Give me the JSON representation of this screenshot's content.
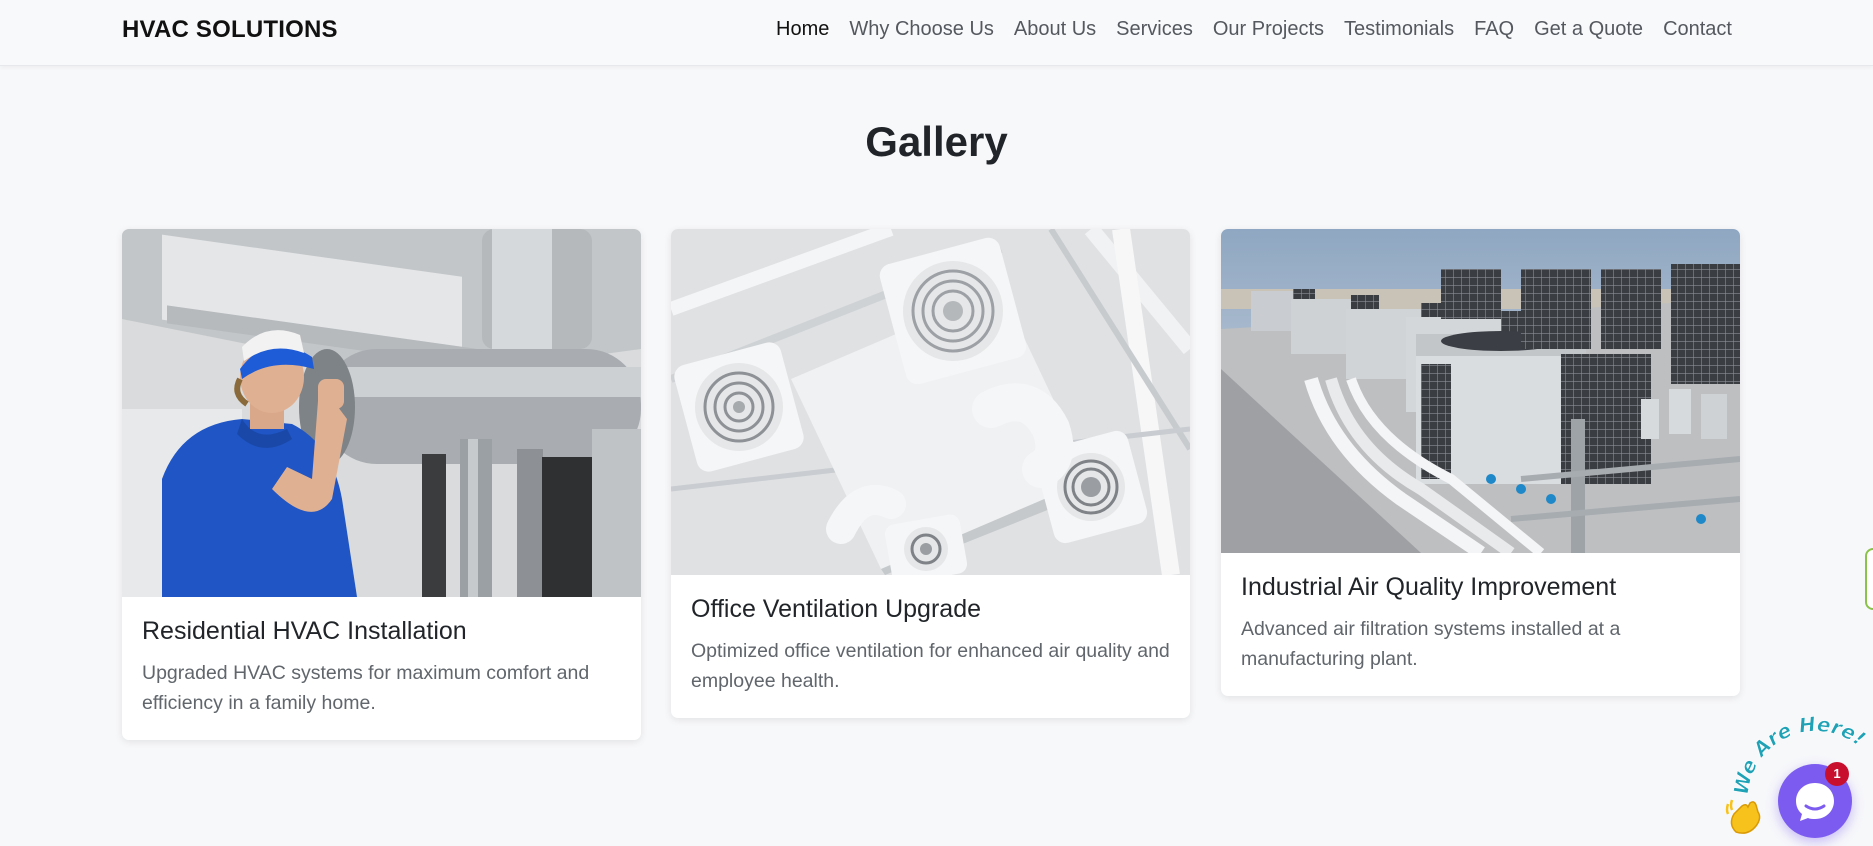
{
  "brand": "HVAC SOLUTIONS",
  "nav": [
    "Home",
    "Why Choose Us",
    "About Us",
    "Services",
    "Our Projects",
    "Testimonials",
    "FAQ",
    "Get a Quote",
    "Contact"
  ],
  "gallery": {
    "title": "Gallery",
    "cards": [
      {
        "title": "Residential HVAC Installation",
        "text": "Upgraded HVAC systems for maximum comfort and efficiency in a family home."
      },
      {
        "title": "Office Ventilation Upgrade",
        "text": "Optimized office ventilation for enhanced air quality and employee health."
      },
      {
        "title": "Industrial Air Quality Improvement",
        "text": "Advanced air filtration systems installed at a manufacturing plant."
      }
    ]
  },
  "chat": {
    "label": "We Are Here!",
    "badge": "1"
  },
  "colors": {
    "accent": "#7c5cf0",
    "badge": "#c8102e",
    "chat_label": "#1fa2b5"
  }
}
